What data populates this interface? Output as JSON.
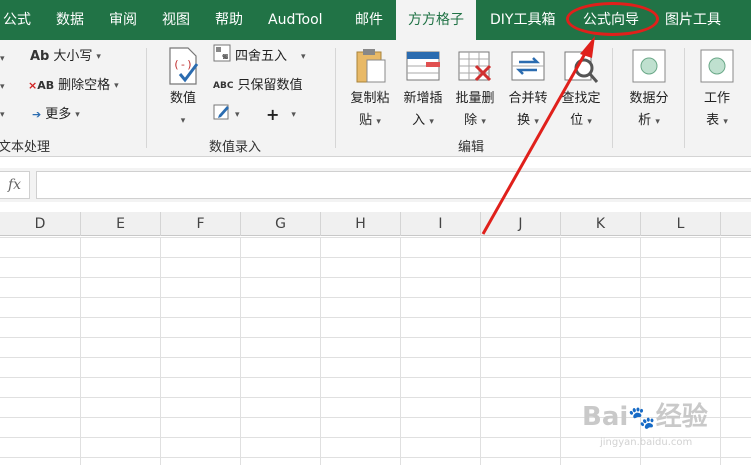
{
  "tabs": [
    {
      "label": "公式",
      "active": false
    },
    {
      "label": "数据",
      "active": false
    },
    {
      "label": "审阅",
      "active": false
    },
    {
      "label": "视图",
      "active": false
    },
    {
      "label": "帮助",
      "active": false
    },
    {
      "label": "AudTool",
      "active": false
    },
    {
      "label": "邮件",
      "active": false
    },
    {
      "label": "方方格子",
      "active": true
    },
    {
      "label": "DIY工具箱",
      "active": false
    },
    {
      "label": "公式向导",
      "active": false
    },
    {
      "label": "图片工具",
      "active": false
    }
  ],
  "ribbon": {
    "text_group": {
      "case_label": "大小写",
      "remove_spaces_label": "删除空格",
      "more_label": "更多",
      "group_label": "文本处理"
    },
    "value_group": {
      "value_label": "数值",
      "round_label": "四舍五入",
      "keep_values_label": "只保留数值",
      "plus_symbol": "+",
      "group_label": "数值录入"
    },
    "edit_group": {
      "copy_paste": [
        "复制粘",
        "贴"
      ],
      "new_insert": [
        "新增插",
        "入"
      ],
      "batch_delete": [
        "批量删",
        "除"
      ],
      "merge_convert": [
        "合并转",
        "换"
      ],
      "find_locate": [
        "查找定",
        "位"
      ],
      "group_label": "编辑"
    },
    "data_analysis": [
      "数据分",
      "析"
    ],
    "worksheet": [
      "工作",
      "表"
    ]
  },
  "formula_bar": {
    "fx_label": "fx",
    "value": ""
  },
  "columns": [
    "D",
    "E",
    "F",
    "G",
    "H",
    "I",
    "J",
    "K",
    "L"
  ],
  "watermark": {
    "brand": "Bai",
    "brand2": "经验",
    "url": "jingyan.baidu.com"
  },
  "colors": {
    "ribbon_green": "#217346",
    "annotation_red": "#e0201b"
  }
}
